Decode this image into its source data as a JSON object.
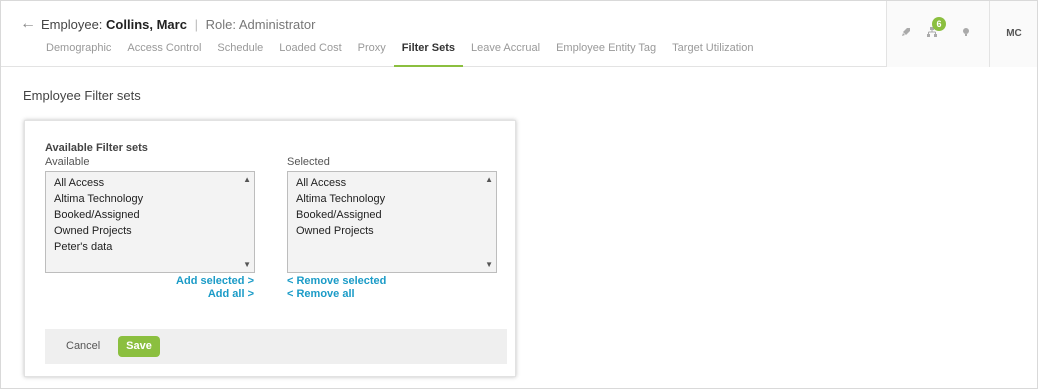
{
  "header": {
    "title_prefix": "Employee:",
    "employee_name": "Collins, Marc",
    "separator": "|",
    "role": "Role: Administrator",
    "back_icon": "arrow-left-icon",
    "tabs": [
      {
        "label": "Demographic",
        "active": false
      },
      {
        "label": "Access Control",
        "active": false
      },
      {
        "label": "Schedule",
        "active": false
      },
      {
        "label": "Loaded Cost",
        "active": false
      },
      {
        "label": "Proxy",
        "active": false
      },
      {
        "label": "Filter Sets",
        "active": true
      },
      {
        "label": "Leave Accrual",
        "active": false
      },
      {
        "label": "Employee Entity Tag",
        "active": false
      },
      {
        "label": "Target Utilization",
        "active": false
      }
    ],
    "right_icons": {
      "rocket_icon": "rocket-icon",
      "hierarchy_icon": "org-chart-icon",
      "notification_count": "6",
      "lightbulb_icon": "lightbulb-icon"
    },
    "avatar_initials": "MC"
  },
  "page": {
    "title": "Employee Filter sets"
  },
  "filter_sets": {
    "section_title": "Available Filter sets",
    "available_label": "Available",
    "selected_label": "Selected",
    "available_items": [
      "All Access",
      "Altima Technology",
      "Booked/Assigned",
      "Owned Projects",
      "Peter's data"
    ],
    "selected_items": [
      "All Access",
      "Altima Technology",
      "Booked/Assigned",
      "Owned Projects"
    ],
    "add_selected": "Add selected >",
    "add_all": "Add all >",
    "remove_selected": "< Remove selected",
    "remove_all": "< Remove all"
  },
  "footer": {
    "cancel_label": "Cancel",
    "save_label": "Save"
  },
  "colors": {
    "accent": "#8bbf3f",
    "link": "#1a9bc7"
  }
}
